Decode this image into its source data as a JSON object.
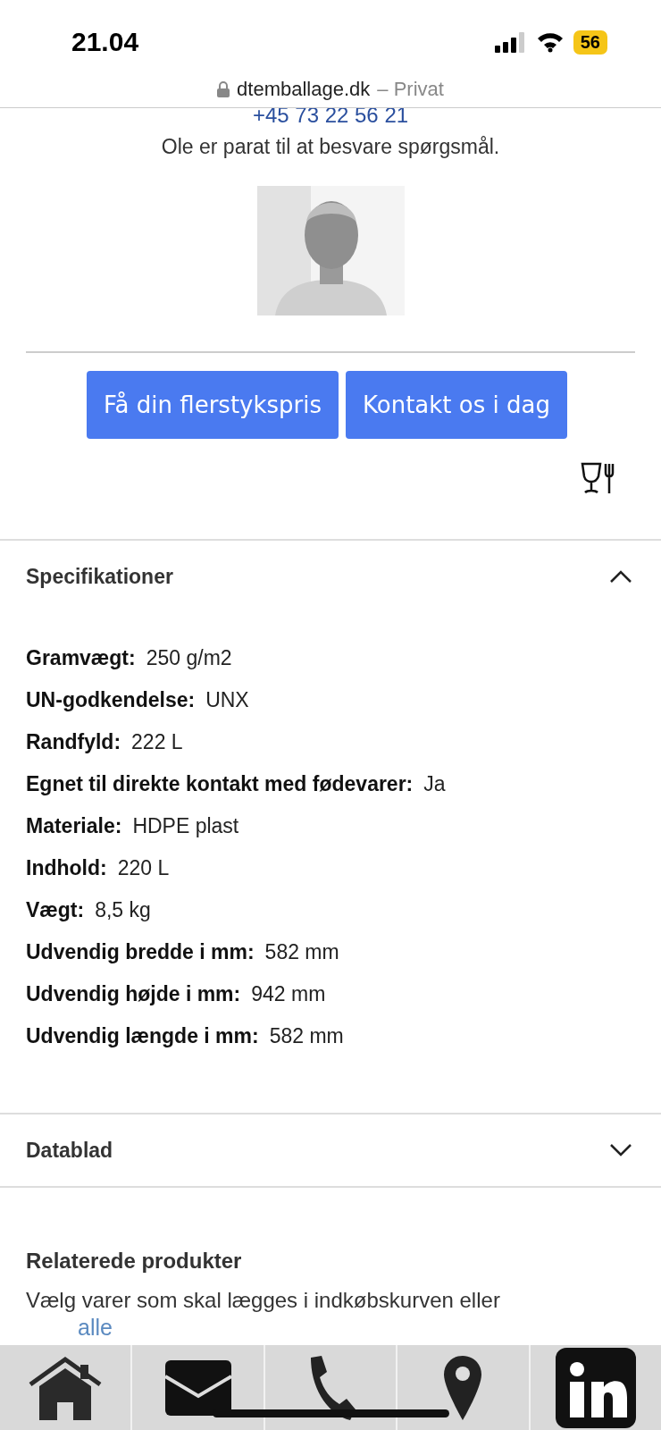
{
  "status_bar": {
    "time": "21.04",
    "battery": "56"
  },
  "address_bar": {
    "domain": "dtemballage.dk",
    "mode": "– Privat"
  },
  "contact": {
    "phone": "+45 73 22 56 21",
    "note": "Ole er parat til at besvare spørgsmål."
  },
  "buttons": [
    "Få din flerstykspris",
    "Kontakt os i dag"
  ],
  "sections": [
    {
      "title": "Specifikationer",
      "expanded": true,
      "specs": [
        {
          "label": "Gramvægt:",
          "value": "250 g/m2"
        },
        {
          "label": "UN-godkendelse:",
          "value": "UNX"
        },
        {
          "label": "Randfyld:",
          "value": "222 L"
        },
        {
          "label": "Egnet til direkte kontakt med fødevarer:",
          "value": "Ja"
        },
        {
          "label": "Materiale:",
          "value": "HDPE plast"
        },
        {
          "label": "Indhold:",
          "value": "220 L"
        },
        {
          "label": "Vægt:",
          "value": "8,5 kg"
        },
        {
          "label": "Udvendig bredde i mm:",
          "value": "582 mm"
        },
        {
          "label": "Udvendig højde i mm:",
          "value": "942 mm"
        },
        {
          "label": "Udvendig længde i mm:",
          "value": "582 mm"
        }
      ]
    },
    {
      "title": "Datablad",
      "expanded": false
    }
  ],
  "related": {
    "title": "Relaterede produkter",
    "text": "Vælg varer som skal lægges i indkøbskurven eller",
    "link": "alle"
  },
  "bottom_nav": [
    {
      "kind": "home"
    },
    {
      "kind": "mail"
    },
    {
      "kind": "phone"
    },
    {
      "kind": "location"
    },
    {
      "kind": "linkedin"
    }
  ]
}
